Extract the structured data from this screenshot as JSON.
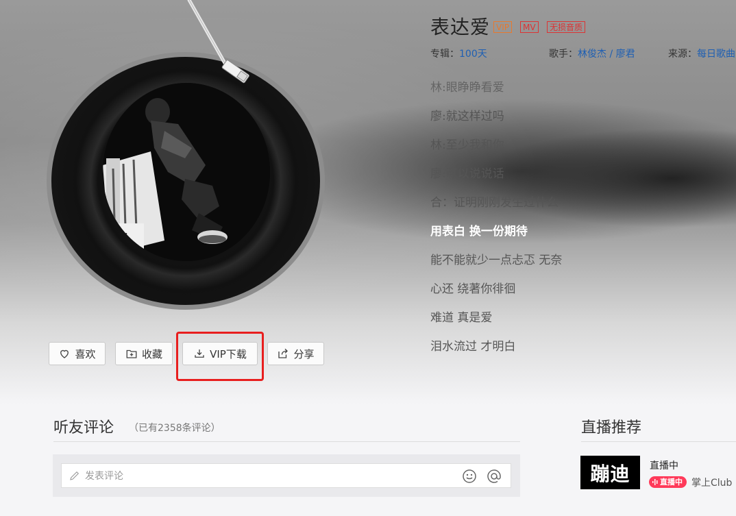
{
  "song": {
    "title": "表达爱",
    "tags": {
      "vip": "VIP",
      "mv": "MV",
      "lossless": "无损音质"
    },
    "album_label": "专辑：",
    "album": "100天",
    "singer_label": "歌手：",
    "singer_1": "林俊杰",
    "singer_sep": " / ",
    "singer_2": "廖君",
    "source_label": "来源：",
    "source": "每日歌曲"
  },
  "lyrics": [
    "林:眼睁睁看爱",
    "廖:就这样过吗",
    "林:至少我和你",
    "廖:可以说说话",
    "合：证明刚刚发生过什么",
    "用表白 换一份期待",
    "能不能就少一点忐忑 无奈",
    "心还 绕著你徘徊",
    "难道 真是爱",
    "泪水流过 才明白"
  ],
  "active_lyric_index": 5,
  "actions": {
    "like": "喜欢",
    "favorite": "收藏",
    "download": "VIP下载",
    "share": "分享"
  },
  "comments": {
    "title": "听友评论",
    "count": "（已有2358条评论）",
    "placeholder": "发表评论"
  },
  "live": {
    "title": "直播推荐",
    "thumb_text": "蹦迪",
    "status": "直播中",
    "badge": "直播中",
    "channel": "掌上Club"
  },
  "colors": {
    "link": "#1e5fb3",
    "highlight": "#e81e1e",
    "vip_tag": "#e8782d",
    "red_tag": "#dd3333",
    "live_badge": "#ff3a5a"
  }
}
